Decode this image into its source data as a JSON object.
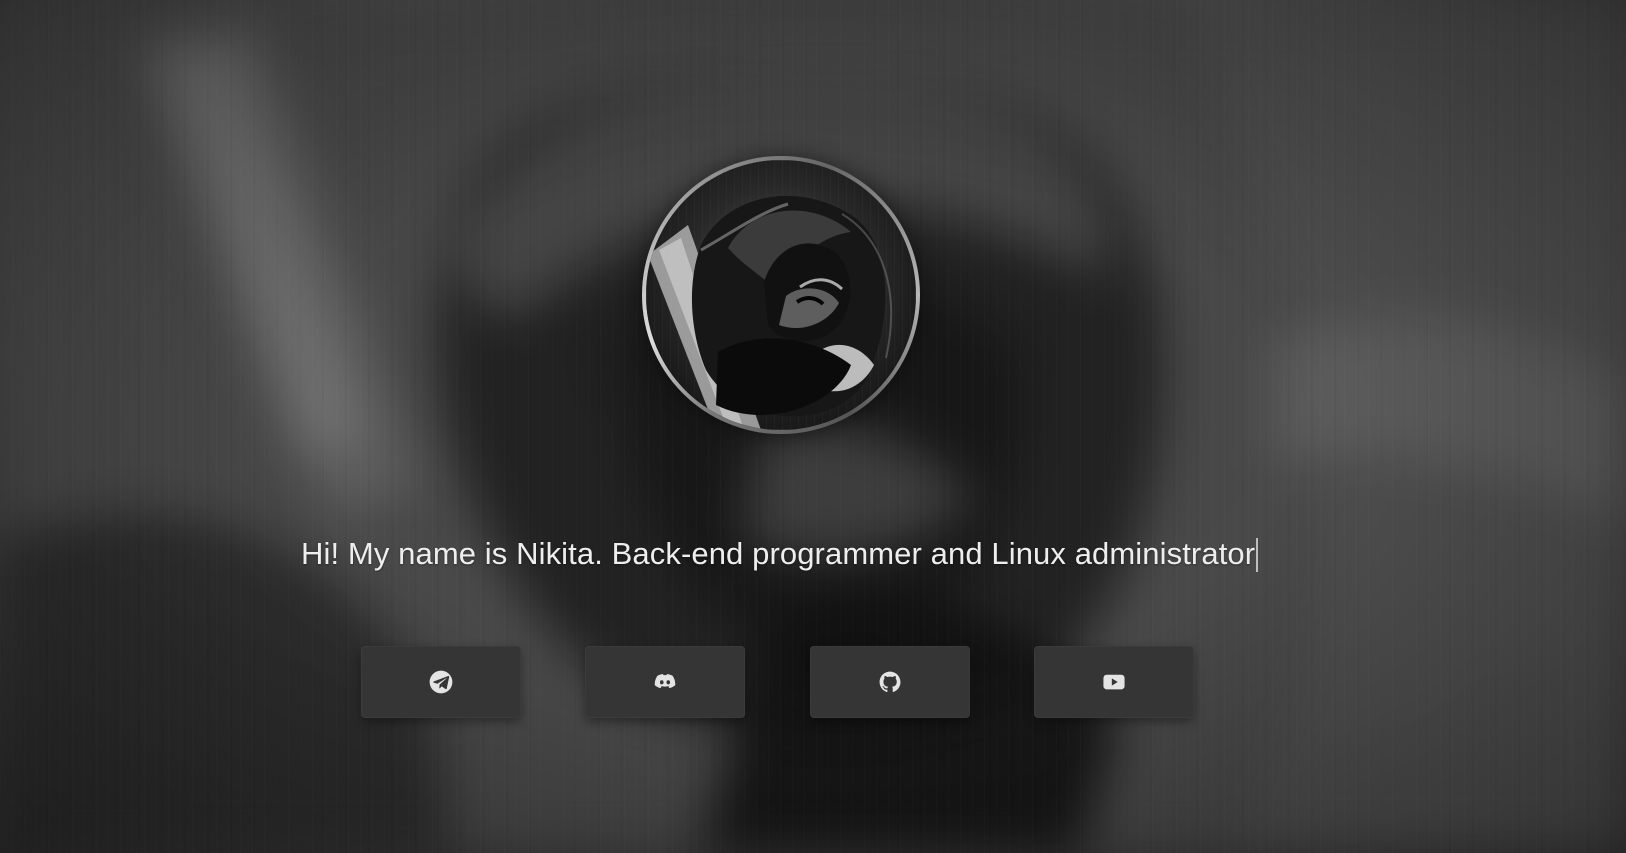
{
  "profile": {
    "intro_text": "Hi! My name is Nikita. Back-end programmer and Linux administrator"
  },
  "social_links": [
    {
      "name": "Telegram",
      "icon": "telegram-icon"
    },
    {
      "name": "Discord",
      "icon": "discord-icon"
    },
    {
      "name": "GitHub",
      "icon": "github-icon"
    },
    {
      "name": "YouTube",
      "icon": "youtube-icon"
    }
  ],
  "theme": {
    "background": "#3a3a3a",
    "button_background": "#353535",
    "text_color": "#eeeeee",
    "icon_color": "#e4e4e4"
  }
}
